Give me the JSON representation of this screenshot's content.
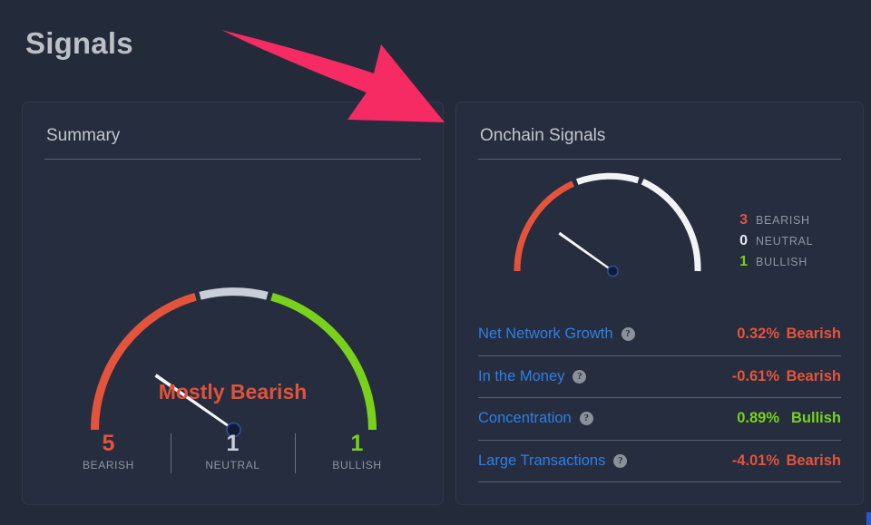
{
  "page": {
    "title": "Signals",
    "background": "#232b3b",
    "card_background": "#252d3e"
  },
  "colors": {
    "bearish": "#e4543c",
    "neutral": "#c9ced8",
    "bullish": "#79d11c",
    "link": "#2f7fe8",
    "muted": "#8f96a3",
    "arrow": "#f72b63",
    "status": "#e0523c"
  },
  "annotation": {
    "arrow_icon": "arrow-pointer-down-right",
    "color": "#f72b63"
  },
  "summary": {
    "title": "Summary",
    "status": "Mostly Bearish",
    "gauge": {
      "segments": [
        {
          "name": "bearish",
          "color": "#e4543c",
          "start_deg": 180,
          "end_deg": 106
        },
        {
          "name": "neutral",
          "color": "#c9ced8",
          "start_deg": 104,
          "end_deg": 76
        },
        {
          "name": "bullish",
          "color": "#79d11c",
          "start_deg": 74,
          "end_deg": 0
        }
      ],
      "needle_deg": 154
    },
    "counts": [
      {
        "value": "5",
        "label": "BEARISH",
        "color": "#e4543c"
      },
      {
        "value": "1",
        "label": "NEUTRAL",
        "color": "#c9ced8"
      },
      {
        "value": "1",
        "label": "BULLISH",
        "color": "#79d11c"
      }
    ]
  },
  "onchain": {
    "title": "Onchain Signals",
    "gauge": {
      "segments": [
        {
          "name": "bearish",
          "color": "#e4543c",
          "start_deg": 180,
          "end_deg": 114
        },
        {
          "name": "neutral",
          "color": "#f2f3f5",
          "start_deg": 112,
          "end_deg": 82
        },
        {
          "name": "bullish",
          "color": "#f2f3f5",
          "start_deg": 80,
          "end_deg": 0
        }
      ],
      "needle_deg": 152
    },
    "legend": [
      {
        "value": "3",
        "label": "BEARISH",
        "color": "#e4543c"
      },
      {
        "value": "0",
        "label": "NEUTRAL",
        "color": "#e8ebef"
      },
      {
        "value": "1",
        "label": "BULLISH",
        "color": "#79d11c"
      }
    ],
    "signals": [
      {
        "name": "Net Network Growth",
        "help": "?",
        "percent": "0.32%",
        "direction": "Bearish",
        "color": "#e4543c"
      },
      {
        "name": "In the Money",
        "help": "?",
        "percent": "-0.61%",
        "direction": "Bearish",
        "color": "#e4543c"
      },
      {
        "name": "Concentration",
        "help": "?",
        "percent": "0.89%",
        "direction": "Bullish",
        "color": "#79d11c"
      },
      {
        "name": "Large Transactions",
        "help": "?",
        "percent": "-4.01%",
        "direction": "Bearish",
        "color": "#e4543c"
      }
    ]
  }
}
